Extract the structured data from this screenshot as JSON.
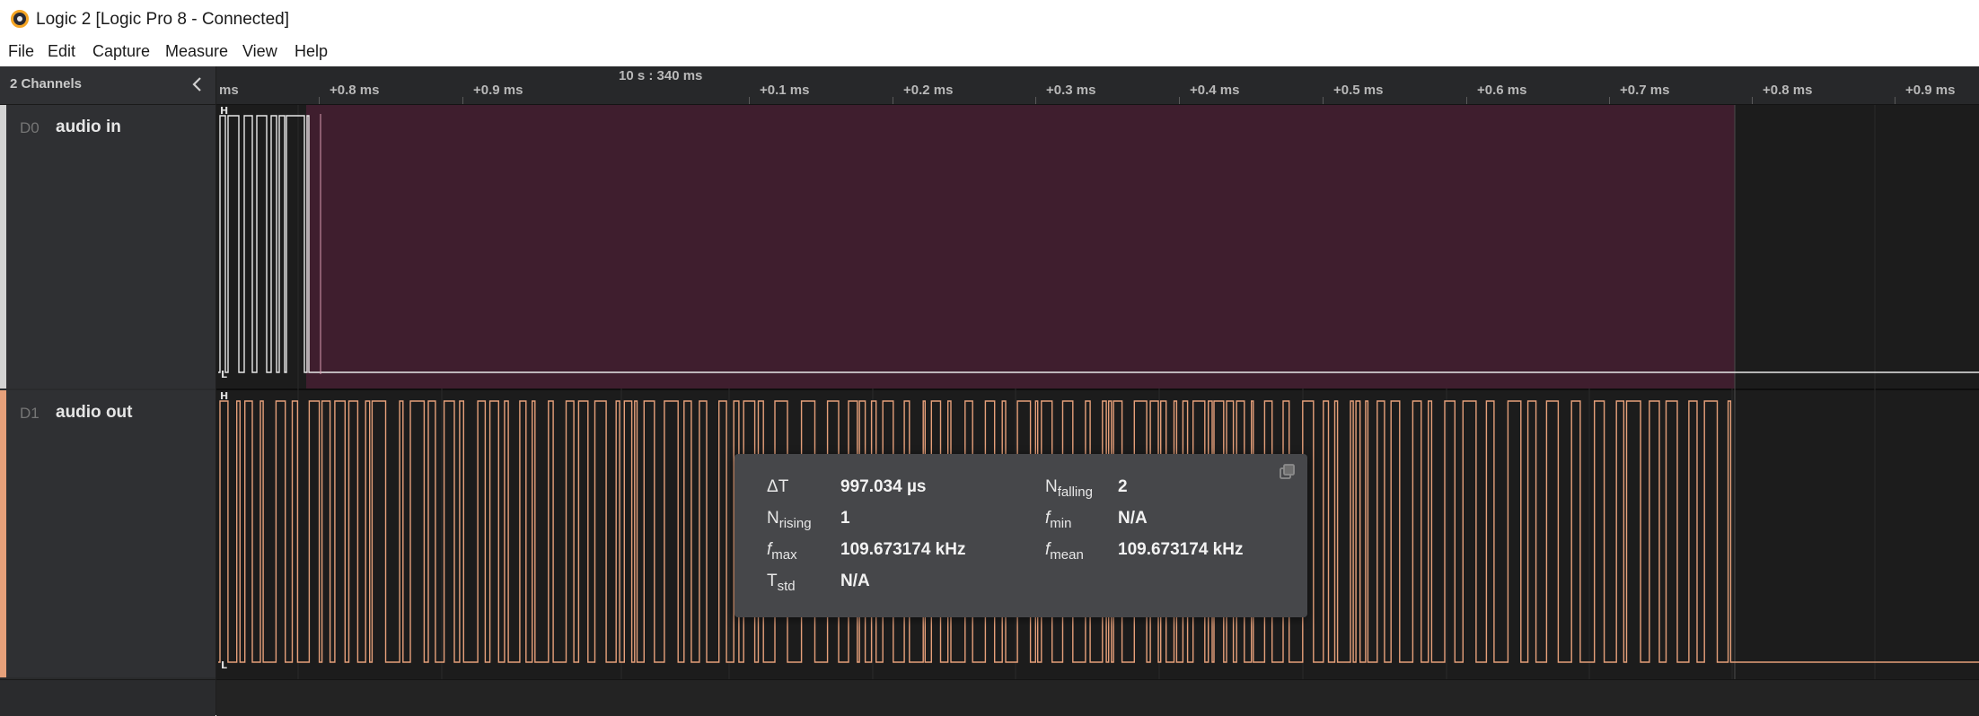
{
  "window": {
    "title": "Logic 2 [Logic Pro 8 - Connected]"
  },
  "menu": [
    "File",
    "Edit",
    "Capture",
    "Measure",
    "View",
    "Help"
  ],
  "sidebar": {
    "header": "2 Channels",
    "channels": [
      {
        "id": "D0",
        "name": "audio in",
        "color": "#d3d3d3"
      },
      {
        "id": "D1",
        "name": "audio out",
        "color": "#e6a07a"
      }
    ]
  },
  "ruler": {
    "reference": "10 s : 340 ms",
    "ticks": [
      "ms",
      "+0.8 ms",
      "+0.9 ms",
      "+0.1 ms",
      "+0.2 ms",
      "+0.3 ms",
      "+0.4 ms",
      "+0.5 ms",
      "+0.6 ms",
      "+0.7 ms",
      "+0.8 ms",
      "+0.9 ms"
    ]
  },
  "waveform": {
    "high_marker": "H",
    "low_marker": "L",
    "selection_color": "#3f1e2e"
  },
  "measurement": {
    "delta_t": {
      "label": "ΔT",
      "value": "997.034 µs"
    },
    "n_falling": {
      "label": "N",
      "sub": "falling",
      "value": "2"
    },
    "n_rising": {
      "label": "N",
      "sub": "rising",
      "value": "1"
    },
    "f_min": {
      "label": "f",
      "sub": "min",
      "value": "N/A"
    },
    "f_max": {
      "label": "f",
      "sub": "max",
      "value": "109.673174 kHz"
    },
    "f_mean": {
      "label": "f",
      "sub": "mean",
      "value": "109.673174 kHz"
    },
    "t_std": {
      "label": "T",
      "sub": "std",
      "value": "N/A"
    },
    "icon": "copy-icon"
  }
}
